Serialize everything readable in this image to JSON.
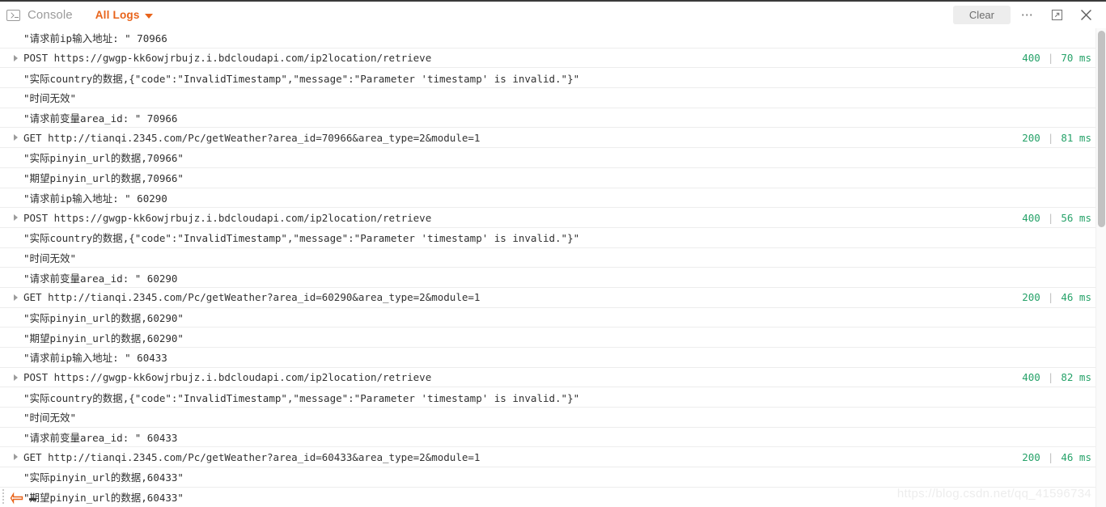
{
  "window": {
    "title": "Console"
  },
  "toolbar": {
    "console_label": "Console",
    "console_icon": "terminal-icon",
    "filter_label": "All Logs",
    "filter_caret": "chevron-down-icon",
    "clear_label": "Clear",
    "more_icon": "ellipsis-icon",
    "popout_icon": "external-link-icon",
    "close_icon": "close-icon"
  },
  "logs": [
    {
      "type": "message",
      "text": "\"请求前ip输入地址: \"  70966"
    },
    {
      "type": "network",
      "method": "POST",
      "url": "https://gwgp-kk6owjrbujz.i.bdcloudapi.com/ip2location/retrieve",
      "status": "400",
      "time": "70 ms"
    },
    {
      "type": "message",
      "text": "\"实际country的数据,{\"code\":\"InvalidTimestamp\",\"message\":\"Parameter 'timestamp' is invalid.\"}\""
    },
    {
      "type": "message",
      "text": "\"时间无效\""
    },
    {
      "type": "message",
      "text": "\"请求前变量area_id: \"  70966"
    },
    {
      "type": "network",
      "method": "GET",
      "url": "http://tianqi.2345.com/Pc/getWeather?area_id=70966&area_type=2&module=1",
      "status": "200",
      "time": "81 ms"
    },
    {
      "type": "message",
      "text": "\"实际pinyin_url的数据,70966\""
    },
    {
      "type": "message",
      "text": "\"期望pinyin_url的数据,70966\""
    },
    {
      "type": "message",
      "text": "\"请求前ip输入地址: \"  60290"
    },
    {
      "type": "network",
      "method": "POST",
      "url": "https://gwgp-kk6owjrbujz.i.bdcloudapi.com/ip2location/retrieve",
      "status": "400",
      "time": "56 ms"
    },
    {
      "type": "message",
      "text": "\"实际country的数据,{\"code\":\"InvalidTimestamp\",\"message\":\"Parameter 'timestamp' is invalid.\"}\""
    },
    {
      "type": "message",
      "text": "\"时间无效\""
    },
    {
      "type": "message",
      "text": "\"请求前变量area_id: \"  60290"
    },
    {
      "type": "network",
      "method": "GET",
      "url": "http://tianqi.2345.com/Pc/getWeather?area_id=60290&area_type=2&module=1",
      "status": "200",
      "time": "46 ms"
    },
    {
      "type": "message",
      "text": "\"实际pinyin_url的数据,60290\""
    },
    {
      "type": "message",
      "text": "\"期望pinyin_url的数据,60290\""
    },
    {
      "type": "message",
      "text": "\"请求前ip输入地址: \"  60433"
    },
    {
      "type": "network",
      "method": "POST",
      "url": "https://gwgp-kk6owjrbujz.i.bdcloudapi.com/ip2location/retrieve",
      "status": "400",
      "time": "82 ms"
    },
    {
      "type": "message",
      "text": "\"实际country的数据,{\"code\":\"InvalidTimestamp\",\"message\":\"Parameter 'timestamp' is invalid.\"}\""
    },
    {
      "type": "message",
      "text": "\"时间无效\""
    },
    {
      "type": "message",
      "text": "\"请求前变量area_id: \"  60433"
    },
    {
      "type": "network",
      "method": "GET",
      "url": "http://tianqi.2345.com/Pc/getWeather?area_id=60433&area_type=2&module=1",
      "status": "200",
      "time": "46 ms"
    },
    {
      "type": "message",
      "text": "\"实际pinyin_url的数据,60433\""
    },
    {
      "type": "message",
      "text": "\"期望pinyin_url的数据,60433\""
    }
  ],
  "watermark": {
    "text": "https://blog.csdn.net/qq_41596734"
  },
  "colors": {
    "accent": "#e8631a",
    "status_ok": "#26a269",
    "text": "#333333",
    "muted": "#9a9a9a"
  }
}
